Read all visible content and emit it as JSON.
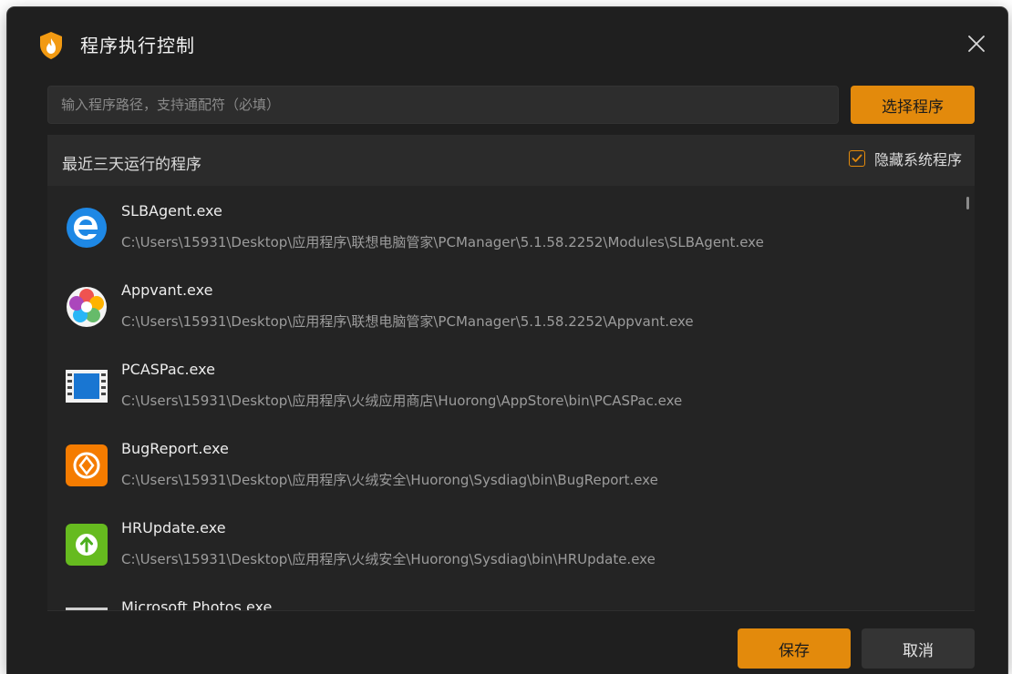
{
  "dialog": {
    "title": "程序执行控制",
    "app_icon": "huorong-shield-flame-icon",
    "close_icon": "close-icon"
  },
  "path_input": {
    "value": "",
    "placeholder": "输入程序路径，支持通配符（必填）"
  },
  "choose_button": {
    "label": "选择程序"
  },
  "list": {
    "title": "最近三天运行的程序",
    "hide_system": {
      "label": "隐藏系统程序",
      "checked": true
    },
    "items": [
      {
        "name": "SLBAgent.exe",
        "path": "C:\\Users\\15931\\Desktop\\应用程序\\联想电脑管家\\PCManager\\5.1.58.2252\\Modules\\SLBAgent.exe",
        "icon": "slbagent-e-icon"
      },
      {
        "name": "Appvant.exe",
        "path": "C:\\Users\\15931\\Desktop\\应用程序\\联想电脑管家\\PCManager\\5.1.58.2252\\Appvant.exe",
        "icon": "appvant-flower-icon"
      },
      {
        "name": "PCASPac.exe",
        "path": "C:\\Users\\15931\\Desktop\\应用程序\\火绒应用商店\\Huorong\\AppStore\\bin\\PCASPac.exe",
        "icon": "pcaspac-window-icon"
      },
      {
        "name": "BugReport.exe",
        "path": "C:\\Users\\15931\\Desktop\\应用程序\\火绒安全\\Huorong\\Sysdiag\\bin\\BugReport.exe",
        "icon": "bugreport-orange-icon"
      },
      {
        "name": "HRUpdate.exe",
        "path": "C:\\Users\\15931\\Desktop\\应用程序\\火绒安全\\Huorong\\Sysdiag\\bin\\HRUpdate.exe",
        "icon": "hrupdate-green-arrow-icon"
      },
      {
        "name": "Microsoft.Photos.exe",
        "path": "",
        "icon": "photos-icon"
      }
    ]
  },
  "footer": {
    "save_label": "保存",
    "cancel_label": "取消"
  },
  "colors": {
    "accent": "#e38a0c",
    "background": "#1f1f1f",
    "panel": "#242424"
  }
}
